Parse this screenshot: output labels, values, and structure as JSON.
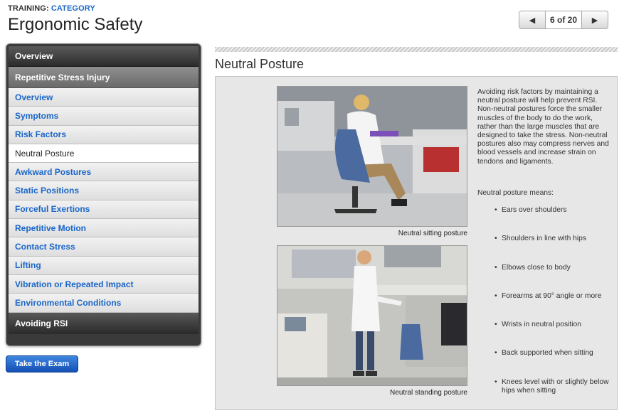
{
  "header": {
    "prefix": "TRAINING:",
    "category": "CATEGORY",
    "title": "Ergonomic Safety"
  },
  "pager": {
    "prev_icon": "◀",
    "page_text": "6 of 20",
    "next_icon": "▶"
  },
  "sidebar": {
    "top_item": "Overview",
    "section": "Repetitive Stress Injury",
    "items": [
      {
        "label": "Overview"
      },
      {
        "label": "Symptoms"
      },
      {
        "label": "Risk Factors"
      },
      {
        "label": "Neutral Posture"
      },
      {
        "label": "Awkward Postures"
      },
      {
        "label": "Static Positions"
      },
      {
        "label": "Forceful Exertions"
      },
      {
        "label": "Repetitive Motion"
      },
      {
        "label": "Contact Stress"
      },
      {
        "label": "Lifting"
      },
      {
        "label": "Vibration or Repeated Impact"
      },
      {
        "label": "Environmental Conditions"
      }
    ],
    "active_index": 3,
    "bottom_item": "Avoiding RSI"
  },
  "exam_button": "Take the Exam",
  "main": {
    "title": "Neutral Posture",
    "caption_sitting": "Neutral sitting posture",
    "caption_standing": "Neutral standing posture",
    "paragraph": "Avoiding risk factors by maintaining a neutral posture will help prevent RSI. Non-neutral postures force the smaller muscles of the body to do the work, rather than the large muscles that are designed to take the stress. Non-neutral postures also may compress nerves and blood vessels and increase strain on tendons and ligaments.",
    "means_label": "Neutral posture means:",
    "bullets": [
      "Ears over shoulders",
      "Shoulders in line with hips",
      "Elbows close to body",
      "Forearms at 90° angle or more",
      "Wrists in neutral position",
      "Back supported when sitting",
      "Knees level with or slightly below hips when sitting"
    ]
  },
  "colors": {
    "link": "#1a66c9",
    "exam_button": "#1550b5",
    "content_bg": "#e7e7e7"
  }
}
